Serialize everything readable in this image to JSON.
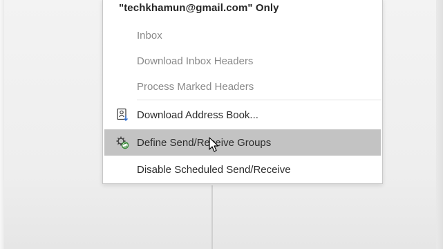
{
  "menu": {
    "header": "\"techkhamun@gmail.com\" Only",
    "items": [
      {
        "label": "Inbox",
        "enabled": false,
        "icon": ""
      },
      {
        "label": "Download Inbox Headers",
        "enabled": false,
        "icon": ""
      },
      {
        "label": "Process Marked Headers",
        "enabled": false,
        "icon": ""
      },
      {
        "label": "Download Address Book...",
        "enabled": true,
        "icon": "address-book-download-icon"
      },
      {
        "label": "Define Send/Receive Groups",
        "enabled": true,
        "icon": "send-receive-groups-icon",
        "highlighted": true
      },
      {
        "label": "Disable Scheduled Send/Receive",
        "enabled": true,
        "icon": ""
      }
    ]
  },
  "colors": {
    "highlight": "#c3c3c3",
    "text": "#2b2b2b",
    "disabled_text": "#8a8a8a",
    "icon_green": "#3c8a3c",
    "icon_blue": "#2f6fd1"
  }
}
